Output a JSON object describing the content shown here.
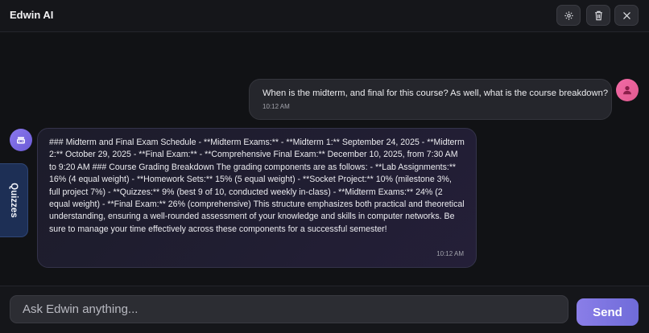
{
  "app": {
    "title": "Edwin AI"
  },
  "header": {
    "buttons": [
      {
        "name": "settings",
        "icon": "gear-icon"
      },
      {
        "name": "clear",
        "icon": "trash-icon"
      },
      {
        "name": "close",
        "icon": "close-icon"
      }
    ]
  },
  "messages": [
    {
      "role": "user",
      "avatar_icon": "user-icon",
      "text": "When is the midterm, and final for this course? As well, what is the course breakdown?",
      "time": "10:12 AM"
    },
    {
      "role": "assistant",
      "avatar_icon": "robot-icon",
      "text": "### Midterm and Final Exam Schedule - **Midterm Exams:** - **Midterm 1:** September 24, 2025 - **Midterm 2:** October 29, 2025 - **Final Exam:** - **Comprehensive Final Exam:** December 10, 2025, from 7:30 AM to 9:20 AM ### Course Grading Breakdown The grading components are as follows: - **Lab Assignments:** 16% (4 equal weight) - **Homework Sets:** 15% (5 equal weight) - **Socket Project:** 10% (milestone 3%, full project 7%) - **Quizzes:** 9% (best 9 of 10, conducted weekly in-class) - **Midterm Exams:** 24% (2 equal weight) - **Final Exam:** 26% (comprehensive) This structure emphasizes both practical and theoretical understanding, ensuring a well-rounded assessment of your knowledge and skills in computer networks. Be sure to manage your time effectively across these components for a successful semester!",
      "time": "10:12 AM"
    }
  ],
  "side_tab": {
    "label": "Quizzes"
  },
  "composer": {
    "placeholder": "Ask Edwin anything...",
    "value": "",
    "send_label": "Send"
  },
  "colors": {
    "background": "#121316",
    "send_accent": "#7f76e2",
    "user_avatar": "#ef67a0",
    "bot_avatar": "#7a69e2",
    "side_tab": "#1d2f55"
  }
}
